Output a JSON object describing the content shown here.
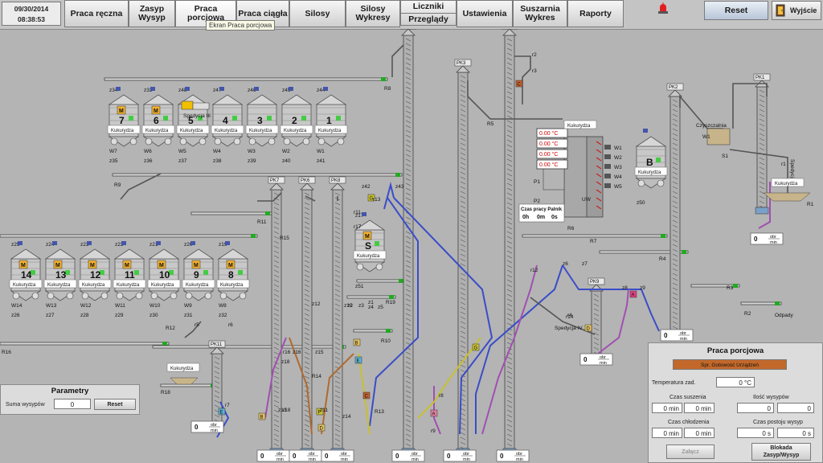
{
  "header": {
    "date": "09/30/2014",
    "time": "08:38:53",
    "tooltip": "Ekran Praca porcjowa",
    "nav": [
      {
        "id": "praca-reczna",
        "label": "Praca ręczna"
      },
      {
        "id": "zasyp-wysyp",
        "label": "Zasyp Wysyp"
      },
      {
        "id": "praca-porcjowa",
        "label": "Praca porcjowa"
      },
      {
        "id": "praca-ciagla",
        "label": "Praca ciągła"
      },
      {
        "id": "silosy",
        "label": "Silosy"
      },
      {
        "id": "silosy-wykresy",
        "label": "Silosy Wykresy"
      },
      {
        "id": "liczniki",
        "label": "Liczniki"
      },
      {
        "id": "przeglady",
        "label": "Przeglądy"
      },
      {
        "id": "ustawienia",
        "label": "Ustawienia"
      },
      {
        "id": "suszarnia-wykres",
        "label": "Suszarnia Wykres"
      },
      {
        "id": "raporty",
        "label": "Raporty"
      }
    ],
    "reset_label": "Reset",
    "exit_label": "Wyjście",
    "alarm_icon": "alarm-beacon-icon",
    "exit_icon": "door-exit-icon"
  },
  "plant": {
    "crop": "Kukurydza",
    "obr_unit_top": "obr",
    "obr_unit_bottom": "min",
    "silos_top": [
      {
        "num": "7",
        "top": "z34",
        "mid": "W7",
        "bot": "z35"
      },
      {
        "num": "6",
        "top": "z33",
        "mid": "W6",
        "bot": "z36"
      },
      {
        "num": "5",
        "top": "z48",
        "mid": "W5",
        "bot": "z37"
      },
      {
        "num": "4",
        "top": "z47",
        "mid": "W4",
        "bot": "z38"
      },
      {
        "num": "3",
        "top": "z46",
        "mid": "W3",
        "bot": "z39"
      },
      {
        "num": "2",
        "top": "z45",
        "mid": "W2",
        "bot": "z40"
      },
      {
        "num": "1",
        "top": "z44",
        "mid": "W1",
        "bot": "z41"
      }
    ],
    "silos_bottom": [
      {
        "num": "14",
        "top": "z25",
        "mid": "W14",
        "bot": "z26"
      },
      {
        "num": "13",
        "top": "z24",
        "mid": "W13",
        "bot": "z27"
      },
      {
        "num": "12",
        "top": "z23",
        "mid": "W12",
        "bot": "z28"
      },
      {
        "num": "11",
        "top": "z22",
        "mid": "W11",
        "bot": "z29"
      },
      {
        "num": "10",
        "top": "z21",
        "mid": "W10",
        "bot": "z30"
      },
      {
        "num": "9",
        "top": "z20",
        "mid": "W9",
        "bot": "z31"
      },
      {
        "num": "8",
        "top": "z19",
        "mid": "W8",
        "bot": "z32"
      }
    ],
    "silo_s": {
      "num": "S",
      "top": "z17",
      "bot": "z51",
      "r": "r10"
    },
    "silo_b": {
      "num": "B",
      "bot": "z50"
    },
    "elevators": [
      "PK4",
      "PK5",
      "PK3",
      "PK2",
      "PK1",
      "PK7",
      "PK6",
      "PK8",
      "PK9",
      "PK11"
    ],
    "labels": {
      "spedycja3": "Spedycja III",
      "spedycja4": "Spedycja IV",
      "spedycja2": "Spedycja II",
      "czyszczalnia": "Czyszczalnia",
      "odpady": "Odpady",
      "palnik": "Czas pracy Palnik",
      "palnik_h": "0h",
      "palnik_m": "0m",
      "palnik_s": "0s",
      "uw": "UW",
      "r": [
        "R1",
        "R2",
        "R3",
        "R4",
        "R5",
        "R6",
        "R7",
        "R8",
        "R9",
        "R10",
        "R11",
        "R12",
        "R13",
        "R14",
        "R15",
        "R16",
        "R18",
        "R19"
      ],
      "small": [
        "r1",
        "r2",
        "r3",
        "r4",
        "r5",
        "r6",
        "r7",
        "r8",
        "r9",
        "r11",
        "r12",
        "r13",
        "r14",
        "r16",
        "r17",
        "r18",
        "z1",
        "z2",
        "z3",
        "z4",
        "z5",
        "z6",
        "z7",
        "z8",
        "z9",
        "z10",
        "z11",
        "z12",
        "z13",
        "z14",
        "z15",
        "z16",
        "z18",
        "z42",
        "z43",
        "P1",
        "P2",
        "W1",
        "S1"
      ]
    },
    "dryer_temps": [
      "0.00 °C",
      "0.00 °C",
      "0.00 °C",
      "0.00 °C"
    ],
    "dryer_w": [
      "W1",
      "W2",
      "W3",
      "W4",
      "W5"
    ],
    "obr_meters": [
      "0",
      "0",
      "0",
      "0",
      "0",
      "0",
      "0",
      "0",
      "0",
      "0",
      "0"
    ]
  },
  "parametry": {
    "title": "Parametry",
    "suma_label": "Suma wysypów",
    "suma_value": "0",
    "reset_label": "Reset"
  },
  "praca_porcjowa": {
    "title": "Praca porcjowa",
    "status": "Spr. Gotowość Urządzeń",
    "temp_label": "Temperatura zad.",
    "temp_value": "0 °C",
    "czas_suszenia_label": "Czas suszenia",
    "czas_suszenia": [
      "0 min",
      "0 min"
    ],
    "ilosc_label": "Ilość wysypów",
    "ilosc": [
      "0",
      "0"
    ],
    "czas_chlodzenia_label": "Czas chłodzenia",
    "czas_chlodzenia": [
      "0 min",
      "0 min"
    ],
    "postoj_label": "Czas postoju wysyp",
    "postoj": [
      "0 s",
      "0 s"
    ],
    "zalacz_label": "Załącz",
    "blokada_label": "Blokada Zasyp/Wysyp"
  }
}
